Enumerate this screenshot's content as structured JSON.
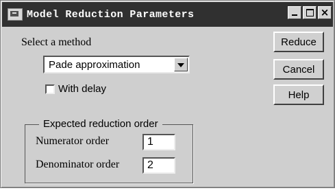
{
  "window": {
    "title": "Model Reduction Parameters",
    "close_glyph": "×"
  },
  "method": {
    "label": "Select a method",
    "selected": "Pade approximation",
    "with_delay_label": "With delay",
    "with_delay_checked": false
  },
  "order": {
    "group_title": "Expected reduction order",
    "numerator_label": "Numerator order",
    "numerator_value": "1",
    "denominator_label": "Denominator order",
    "denominator_value": "2"
  },
  "buttons": {
    "reduce": "Reduce",
    "cancel": "Cancel",
    "help": "Help"
  }
}
